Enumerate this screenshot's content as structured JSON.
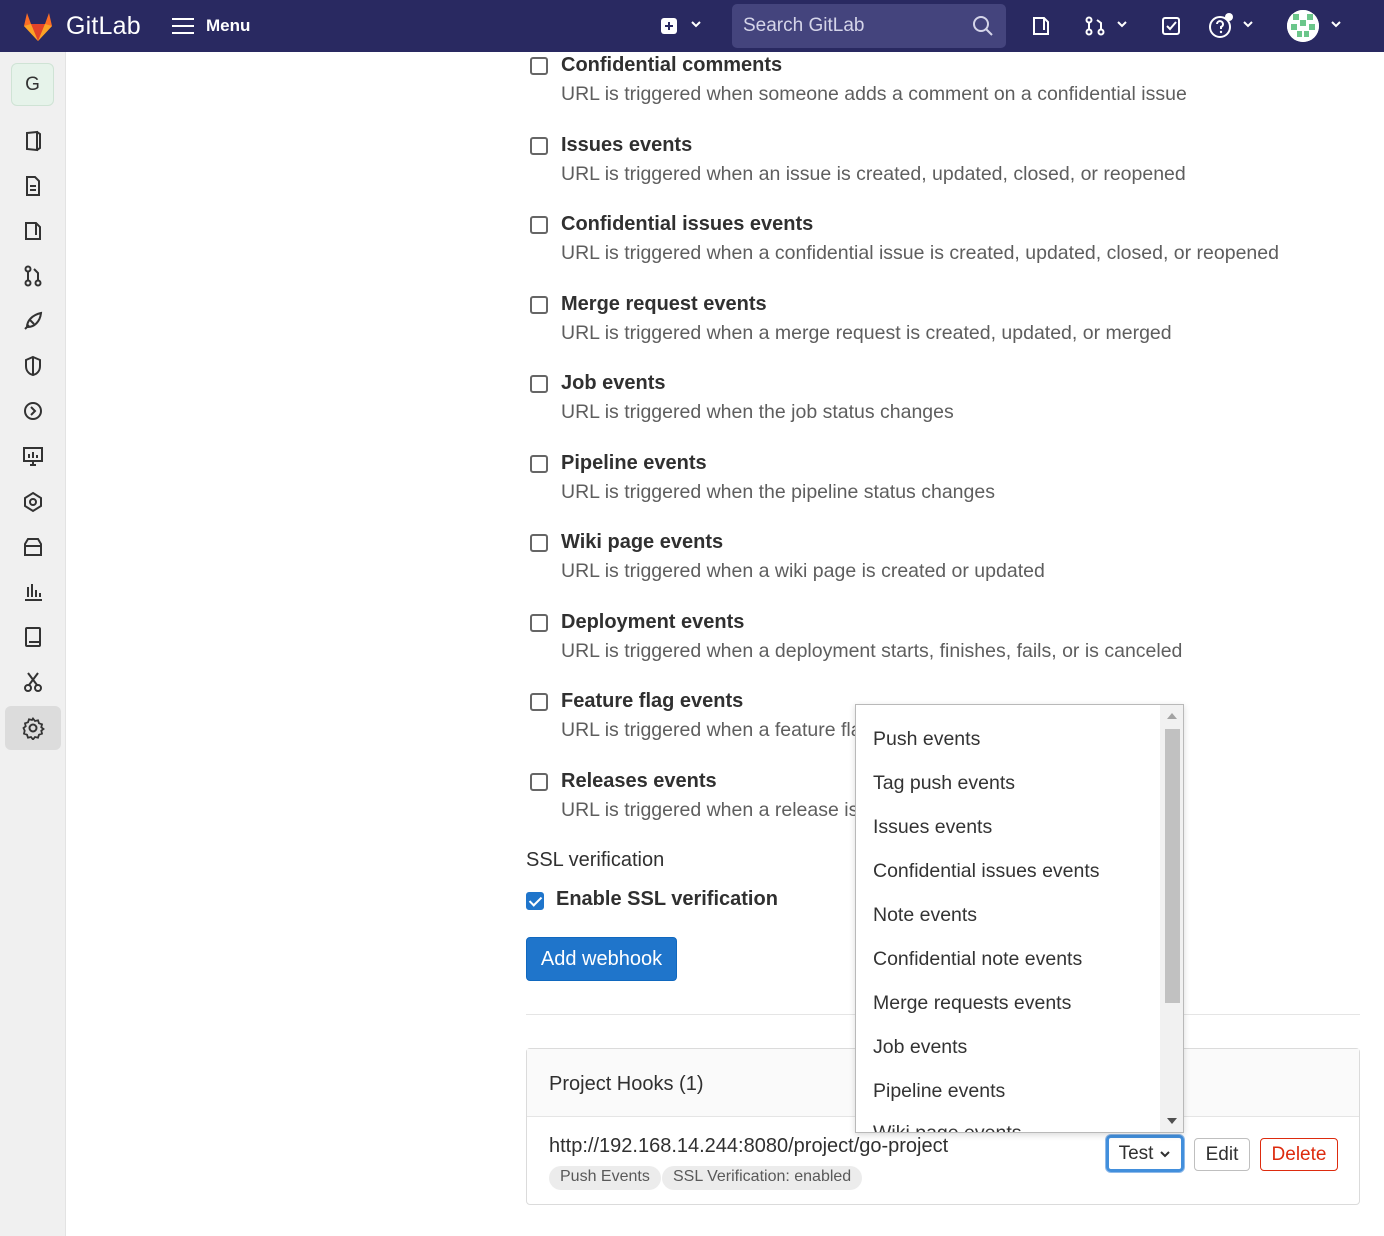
{
  "header": {
    "brand": "GitLab",
    "menu_label": "Menu",
    "search_placeholder": "Search GitLab"
  },
  "sidebar": {
    "project_initial": "G",
    "items": [
      {
        "icon": "project-overview-icon"
      },
      {
        "icon": "repository-icon"
      },
      {
        "icon": "issues-icon"
      },
      {
        "icon": "merge-requests-icon"
      },
      {
        "icon": "ci-cd-icon"
      },
      {
        "icon": "security-icon"
      },
      {
        "icon": "deployments-icon"
      },
      {
        "icon": "monitor-icon"
      },
      {
        "icon": "infrastructure-icon"
      },
      {
        "icon": "packages-icon"
      },
      {
        "icon": "analytics-icon"
      },
      {
        "icon": "wiki-icon"
      },
      {
        "icon": "snippets-icon"
      },
      {
        "icon": "settings-icon"
      }
    ]
  },
  "events": [
    {
      "title": "Confidential comments",
      "desc": "URL is triggered when someone adds a comment on a confidential issue",
      "checked": false
    },
    {
      "title": "Issues events",
      "desc": "URL is triggered when an issue is created, updated, closed, or reopened",
      "checked": false
    },
    {
      "title": "Confidential issues events",
      "desc": "URL is triggered when a confidential issue is created, updated, closed, or reopened",
      "checked": false
    },
    {
      "title": "Merge request events",
      "desc": "URL is triggered when a merge request is created, updated, or merged",
      "checked": false
    },
    {
      "title": "Job events",
      "desc": "URL is triggered when the job status changes",
      "checked": false
    },
    {
      "title": "Pipeline events",
      "desc": "URL is triggered when the pipeline status changes",
      "checked": false
    },
    {
      "title": "Wiki page events",
      "desc": "URL is triggered when a wiki page is created or updated",
      "checked": false
    },
    {
      "title": "Deployment events",
      "desc": "URL is triggered when a deployment starts, finishes, fails, or is canceled",
      "checked": false
    },
    {
      "title": "Feature flag events",
      "desc": "URL is triggered when a feature fla",
      "checked": false
    },
    {
      "title": "Releases events",
      "desc": "URL is triggered when a release is c",
      "checked": false
    }
  ],
  "ssl": {
    "heading": "SSL verification",
    "checkbox_label": "Enable SSL verification",
    "checked": true
  },
  "add_webhook_label": "Add webhook",
  "project_hooks": {
    "title": "Project Hooks (1)",
    "hook": {
      "url": "http://192.168.14.244:8080/project/go-project",
      "badges": [
        "Push Events",
        "SSL Verification: enabled"
      ],
      "test_label": "Test",
      "edit_label": "Edit",
      "delete_label": "Delete"
    }
  },
  "test_dropdown": {
    "options": [
      "Push events",
      "Tag push events",
      "Issues events",
      "Confidential issues events",
      "Note events",
      "Confidential note events",
      "Merge requests events",
      "Job events",
      "Pipeline events",
      "Wiki page events"
    ]
  },
  "colors": {
    "navbar": "#292961",
    "primary_button": "#1f75cb",
    "danger": "#dd2b0e"
  }
}
